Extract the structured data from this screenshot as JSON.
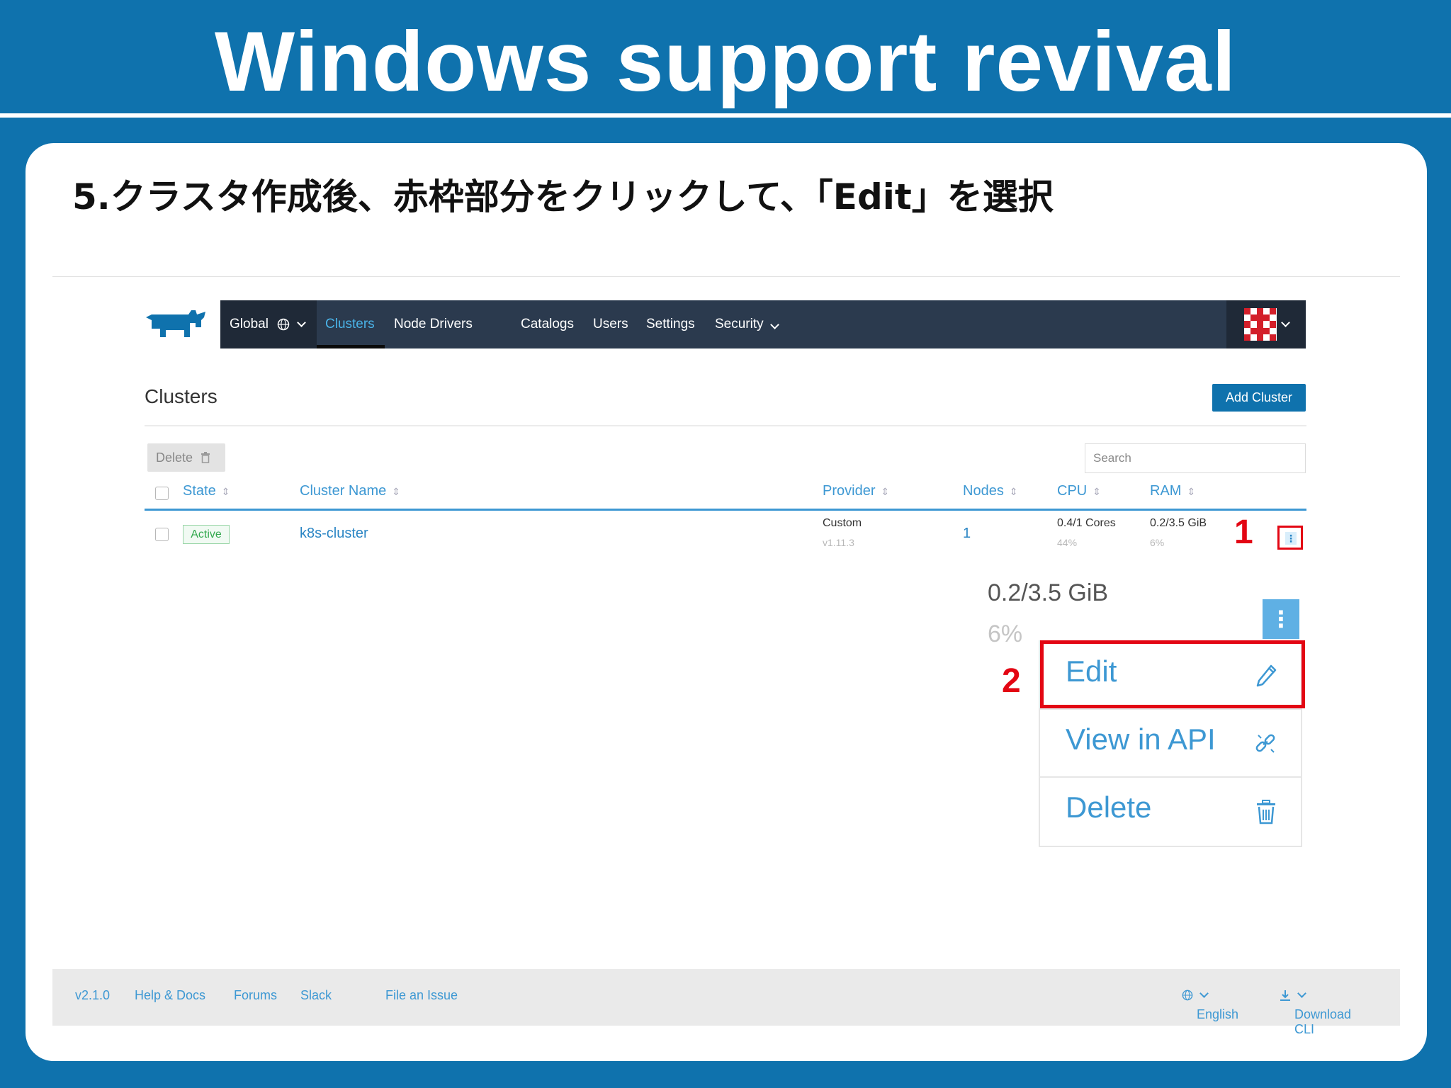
{
  "slide": {
    "title": "Windows support revival",
    "instruction": "5.クラスタ作成後、赤枠部分をクリックして、「Edit」を選択"
  },
  "nav": {
    "global_label": "Global",
    "items": [
      "Clusters",
      "Node Drivers",
      "Catalogs",
      "Users",
      "Settings",
      "Security"
    ],
    "active_item": "Clusters"
  },
  "page": {
    "heading": "Clusters",
    "add_cluster_label": "Add Cluster",
    "delete_label": "Delete",
    "search_placeholder": "Search"
  },
  "table": {
    "columns": [
      "State",
      "Cluster Name",
      "Provider",
      "Nodes",
      "CPU",
      "RAM"
    ],
    "rows": [
      {
        "state": "Active",
        "name": "k8s-cluster",
        "provider": "Custom",
        "provider_version": "v1.11.3",
        "nodes": "1",
        "cpu": "0.4/1 Cores",
        "cpu_pct": "44%",
        "ram": "0.2/3.5 GiB",
        "ram_pct": "6%"
      }
    ]
  },
  "callouts": {
    "step1": "1",
    "step2": "2",
    "accent_color": "#e30613"
  },
  "zoom": {
    "ram": "0.2/3.5 GiB",
    "ram_pct": "6%",
    "menu": [
      {
        "label": "Edit",
        "icon": "pencil-icon"
      },
      {
        "label": "View in API",
        "icon": "link-icon"
      },
      {
        "label": "Delete",
        "icon": "trash-icon"
      }
    ]
  },
  "footer": {
    "version": "v2.1.0",
    "links": [
      "Help & Docs",
      "Forums",
      "Slack",
      "File an Issue"
    ],
    "language": "English",
    "download": "Download CLI"
  },
  "colors": {
    "slide_bg": "#0f72ad",
    "navbar": "#2b3a4e",
    "link_blue": "#3d98d3",
    "active_green": "#34a94f"
  }
}
